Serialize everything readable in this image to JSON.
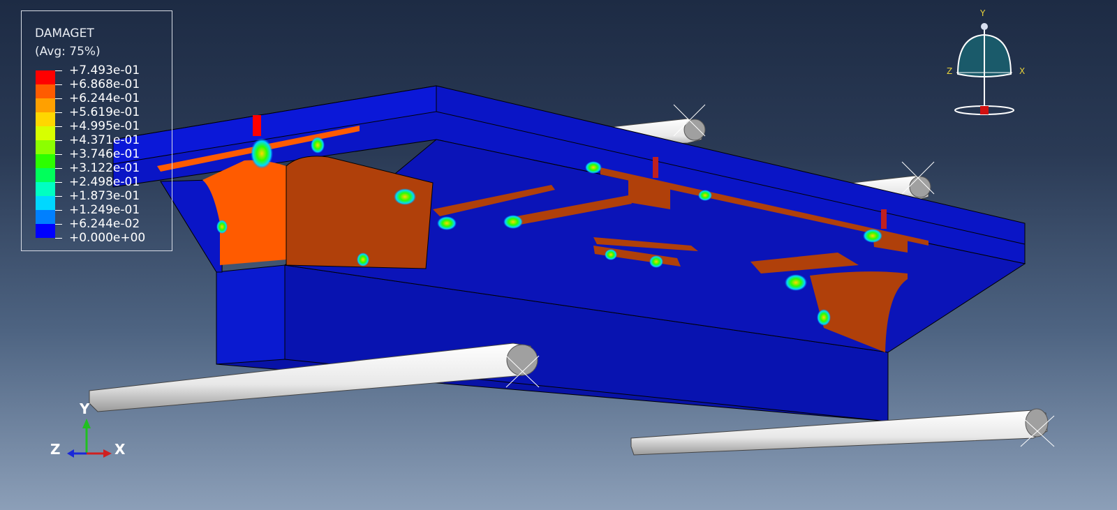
{
  "legend": {
    "title": "DAMAGET",
    "subtitle": "(Avg: 75%)",
    "entries": [
      {
        "label": "+7.493e-01",
        "color": "#ff0000"
      },
      {
        "label": "+6.868e-01",
        "color": "#ff5b00"
      },
      {
        "label": "+6.244e-01",
        "color": "#ffa000"
      },
      {
        "label": "+5.619e-01",
        "color": "#ffd700"
      },
      {
        "label": "+4.995e-01",
        "color": "#d7ff00"
      },
      {
        "label": "+4.371e-01",
        "color": "#8cff00"
      },
      {
        "label": "+3.746e-01",
        "color": "#2cff00"
      },
      {
        "label": "+3.122e-01",
        "color": "#00ff5b"
      },
      {
        "label": "+2.498e-01",
        "color": "#00ffc2"
      },
      {
        "label": "+1.873e-01",
        "color": "#00d8ff"
      },
      {
        "label": "+1.249e-01",
        "color": "#0080ff"
      },
      {
        "label": "+6.244e-02",
        "color": "#0021ff"
      },
      {
        "label": "+0.000e+00"
      }
    ]
  },
  "view_cube": {
    "y_label": "Y",
    "z_label": "Z",
    "x_label": "X"
  },
  "triad": {
    "y_label": "Y",
    "z_label": "Z",
    "x_label": "X"
  },
  "colors": {
    "background_top": "#1d2b44",
    "background_bottom": "#8c9fb8",
    "model_blue": "#0a14c8",
    "damage_orange": "#b0400a",
    "damage_peak": "#ff0000"
  }
}
